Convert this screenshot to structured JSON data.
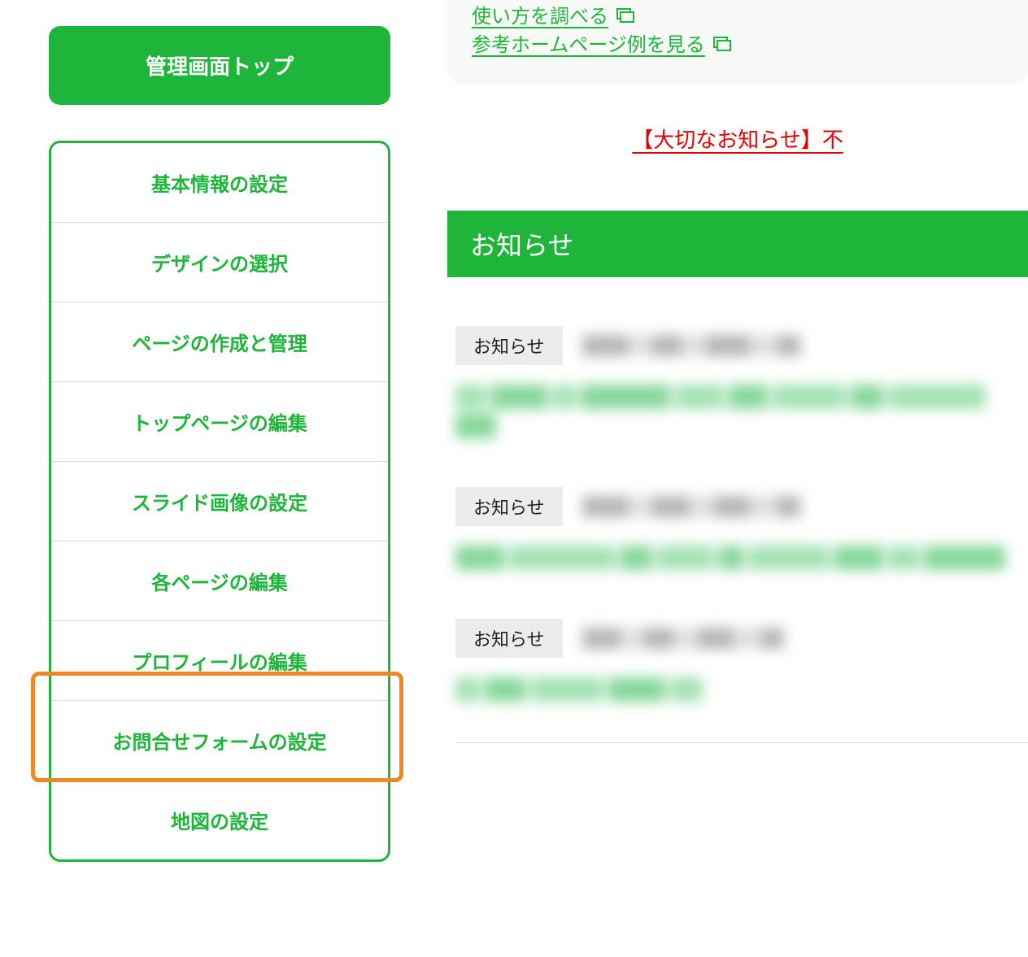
{
  "sidebar": {
    "top_button": "管理画面トップ",
    "items": [
      {
        "label": "基本情報の設定"
      },
      {
        "label": "デザインの選択"
      },
      {
        "label": "ページの作成と管理"
      },
      {
        "label": "トップページの編集"
      },
      {
        "label": "スライド画像の設定"
      },
      {
        "label": "各ページの編集"
      },
      {
        "label": "プロフィールの編集"
      },
      {
        "label": "お問合せフォームの設定"
      },
      {
        "label": "地図の設定"
      }
    ]
  },
  "help": {
    "link1": "使い方を調べる",
    "link2": "参考ホームページ例を見る"
  },
  "notice": {
    "important": "【大切なお知らせ】不"
  },
  "section": {
    "news_title": "お知らせ"
  },
  "news": {
    "badge": "お知らせ"
  }
}
